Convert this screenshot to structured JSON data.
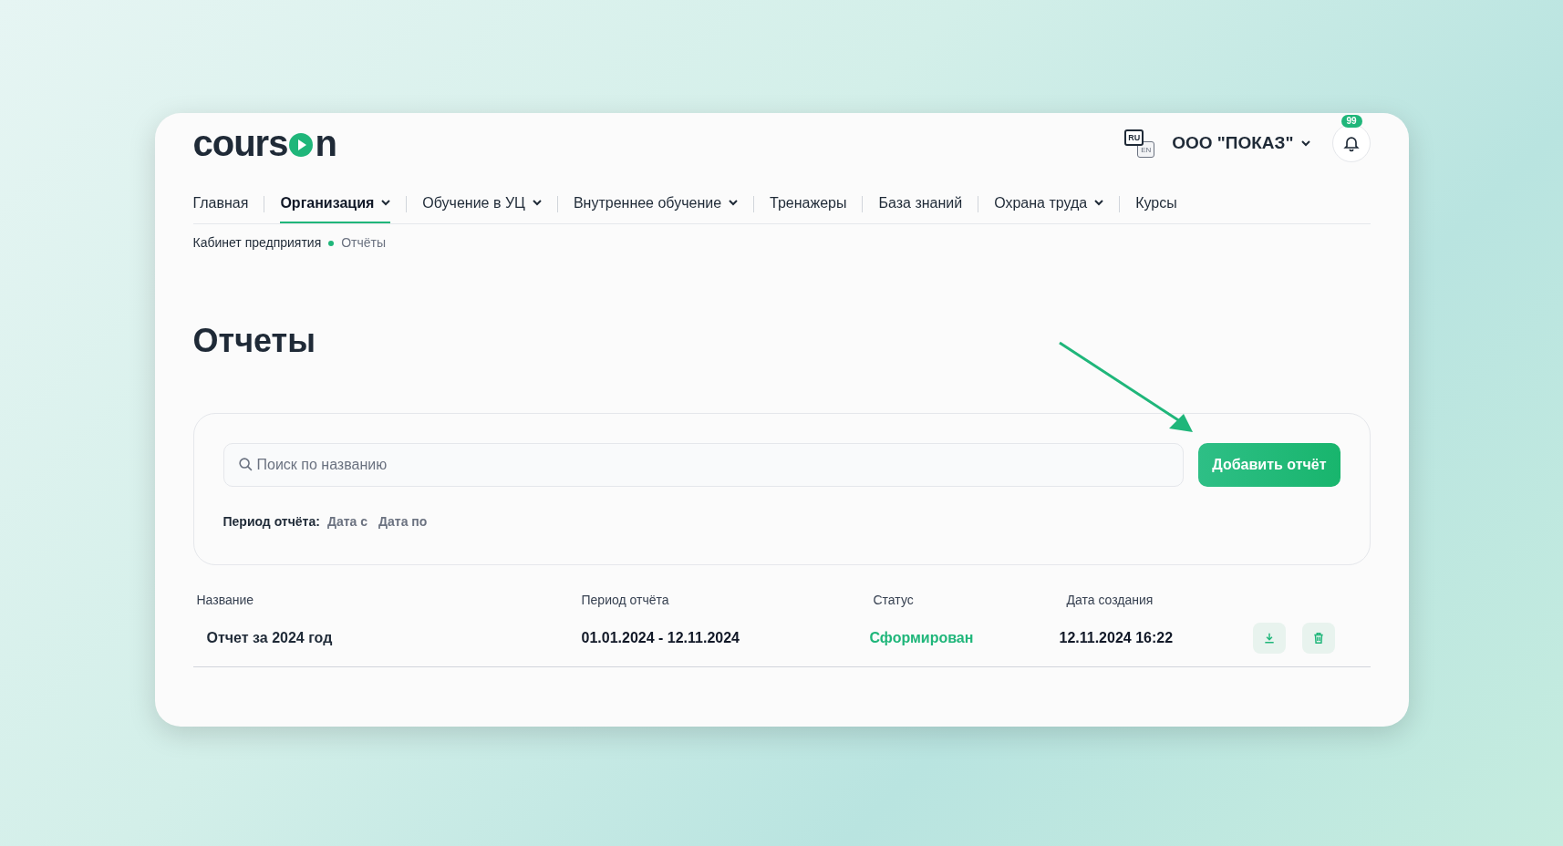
{
  "logo": {
    "before": "cours",
    "after": "n"
  },
  "header": {
    "languages": [
      {
        "label": "RU",
        "selected": true
      },
      {
        "label": "EN",
        "selected": false
      }
    ],
    "org": "ООО \"ПОКАЗ\"",
    "notifications": "99"
  },
  "nav": [
    {
      "label": "Главная",
      "selected": false,
      "has_menu": false
    },
    {
      "label": "Организация",
      "selected": true,
      "has_menu": true
    },
    {
      "label": "Обучение в УЦ",
      "selected": false,
      "has_menu": true
    },
    {
      "label": "Внутреннее обучение",
      "selected": false,
      "has_menu": true
    },
    {
      "label": "Тренажеры",
      "selected": false,
      "has_menu": false
    },
    {
      "label": "База знаний",
      "selected": false,
      "has_menu": false
    },
    {
      "label": "Охрана труда",
      "selected": false,
      "has_menu": true
    },
    {
      "label": "Курсы",
      "selected": false,
      "has_menu": false
    }
  ],
  "breadcrumbs": [
    "Кабинет предприятия",
    "Отчёты"
  ],
  "title": "Отчеты",
  "filters": {
    "search_placeholder": "Поиск по названию",
    "add_button": "Добавить отчёт",
    "period_label": "Период отчёта:",
    "date_from": "Дата с",
    "date_to": "Дата по"
  },
  "table": {
    "columns": [
      "Название",
      "Период отчёта",
      "Статус",
      "Дата создания"
    ],
    "rows": [
      {
        "name": "Отчет за 2024 год",
        "period": "01.01.2024 - 12.11.2024",
        "status": "Сформирован",
        "color": "#1fb67a",
        "created": "12.11.2024 16:22"
      }
    ]
  }
}
